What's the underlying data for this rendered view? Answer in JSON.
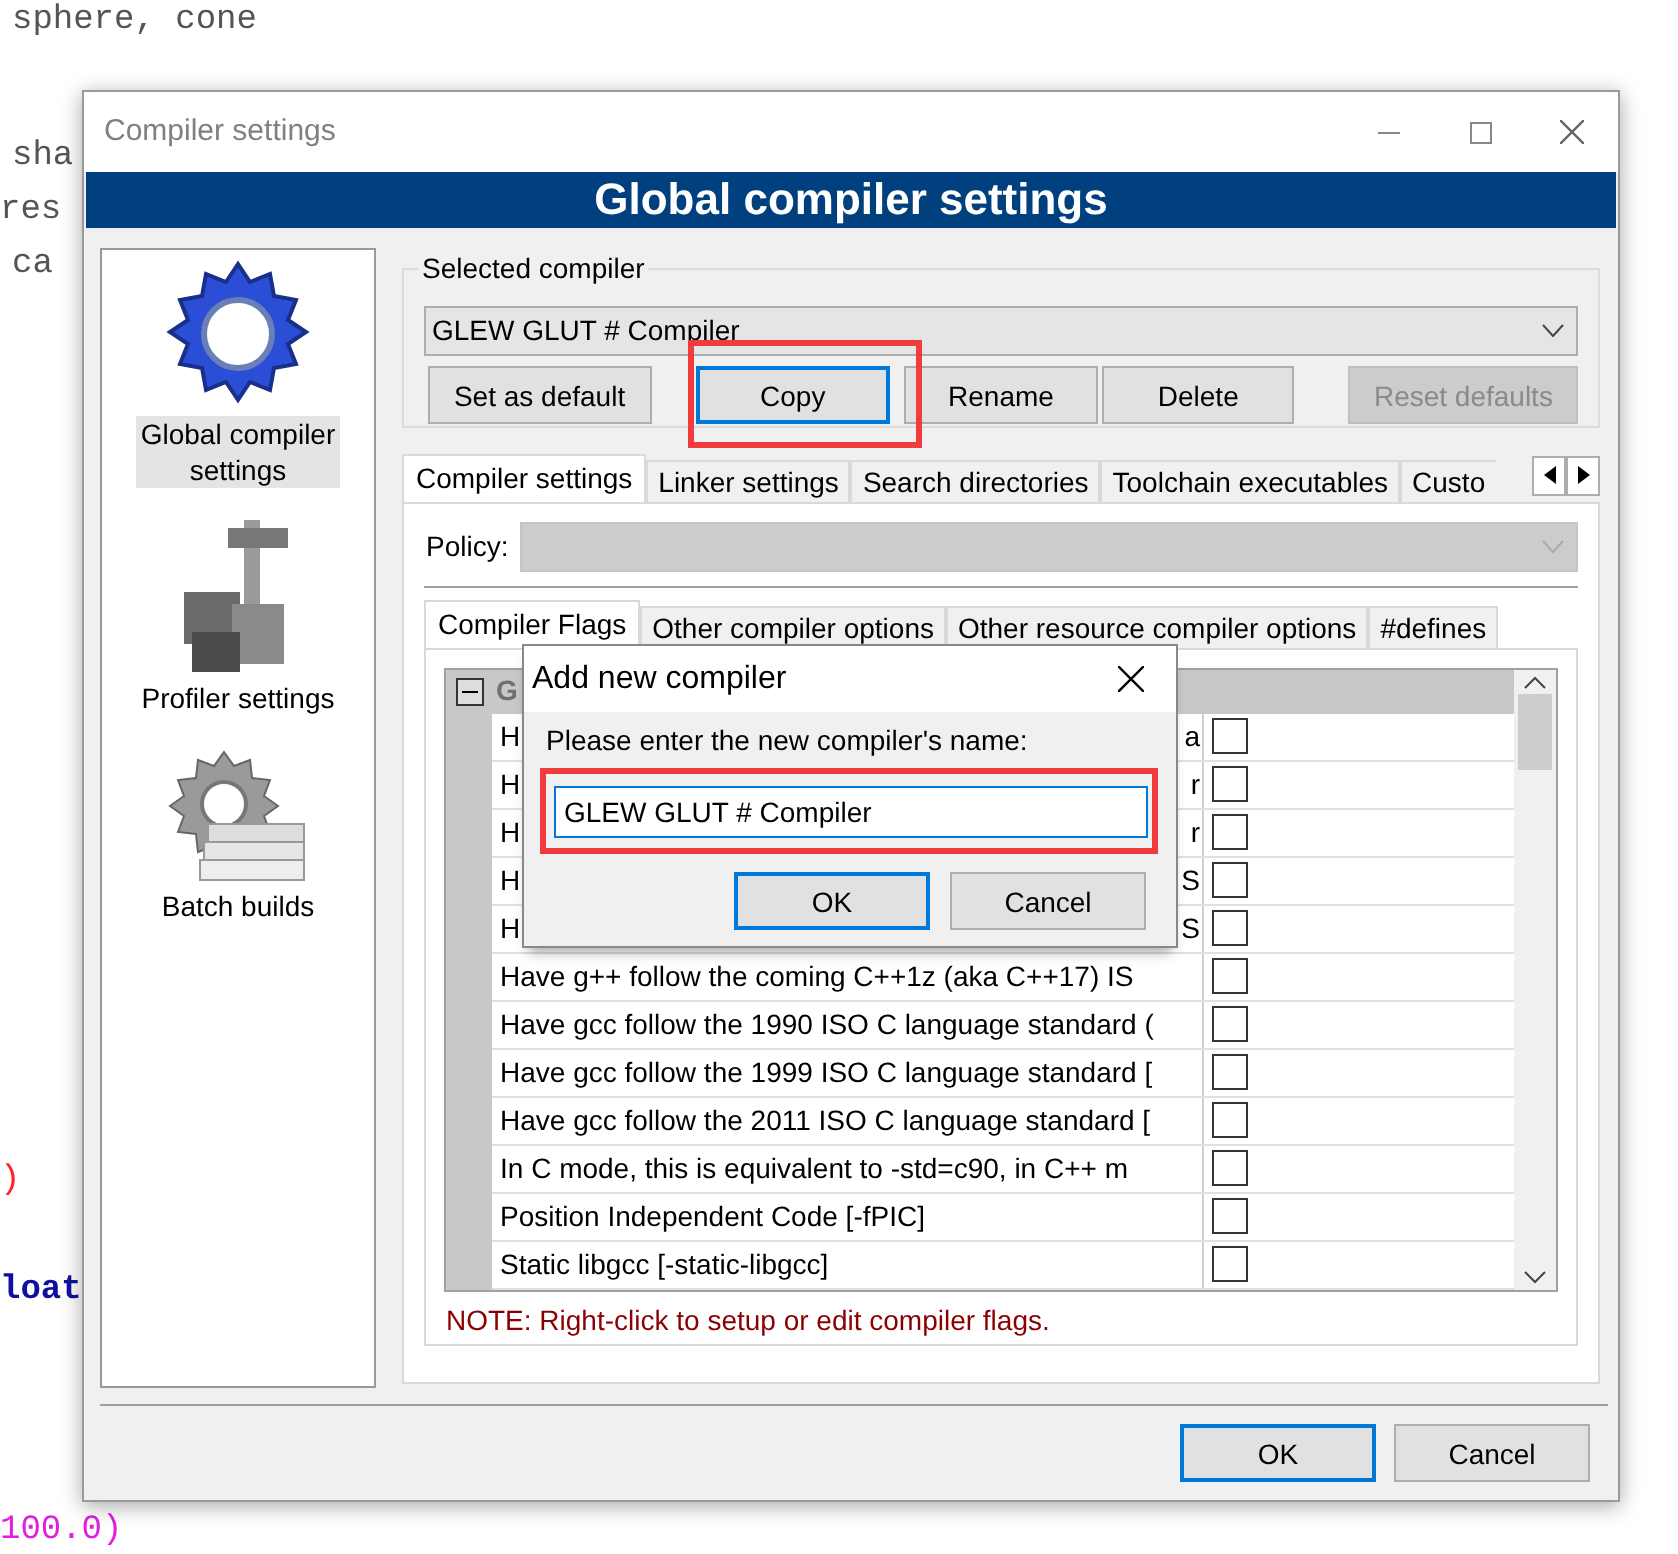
{
  "background_code": [
    {
      "text": "sphere, cone",
      "color": "#555555",
      "bold": false
    },
    {
      "text": "sha",
      "color": "#555555",
      "bold": false
    },
    {
      "text": "res",
      "color": "#555555",
      "bold": false
    },
    {
      "text": "ca",
      "color": "#555555",
      "bold": false
    },
    {
      "text": ")",
      "color": "#ff2020",
      "bold": false
    },
    {
      "text": "loat",
      "color": "#1010a0",
      "bold": true
    },
    {
      "text": "100.0)",
      "color": "#e020e0",
      "bold": false
    }
  ],
  "window": {
    "title": "Compiler settings"
  },
  "banner": "Global compiler settings",
  "sidebar": {
    "items": [
      {
        "label": "Global compiler settings",
        "selected": true,
        "kind": "gear"
      },
      {
        "label": "Profiler settings",
        "selected": false,
        "kind": "profiler"
      },
      {
        "label": "Batch builds",
        "selected": false,
        "kind": "batch"
      }
    ]
  },
  "selected_compiler": {
    "legend": "Selected compiler",
    "value": "GLEW GLUT # Compiler",
    "buttons": [
      {
        "label": "Set as default",
        "focused": false,
        "disabled": false,
        "highlighted": false
      },
      {
        "label": "Copy",
        "focused": true,
        "disabled": false,
        "highlighted": true
      },
      {
        "label": "Rename",
        "focused": false,
        "disabled": false,
        "highlighted": false
      },
      {
        "label": "Delete",
        "focused": false,
        "disabled": false,
        "highlighted": false
      },
      {
        "label": "Reset defaults",
        "focused": false,
        "disabled": true,
        "highlighted": false
      }
    ]
  },
  "tabs": [
    {
      "label": "Compiler settings",
      "selected": true
    },
    {
      "label": "Linker settings",
      "selected": false
    },
    {
      "label": "Search directories",
      "selected": false
    },
    {
      "label": "Toolchain executables",
      "selected": false
    },
    {
      "label": "Custo",
      "selected": false
    }
  ],
  "policy": {
    "label": "Policy:",
    "disabled": true
  },
  "inner_tabs": [
    {
      "label": "Compiler Flags",
      "selected": true
    },
    {
      "label": "Other compiler options",
      "selected": false
    },
    {
      "label": "Other resource compiler options",
      "selected": false
    },
    {
      "label": "#defines",
      "selected": false
    }
  ],
  "flags": {
    "group": {
      "label": "G",
      "expanded": true
    },
    "rows": [
      {
        "text": "H",
        "tail": "a",
        "checked": false
      },
      {
        "text": "H",
        "tail": "r",
        "checked": false
      },
      {
        "text": "H",
        "tail": "r",
        "checked": false
      },
      {
        "text": "H",
        "tail": "S",
        "checked": false
      },
      {
        "text": "H",
        "tail": "S",
        "checked": false
      },
      {
        "text": "Have g++ follow the coming C++1z (aka C++17) IS",
        "checked": false
      },
      {
        "text": "Have gcc follow the 1990 ISO C language standard  (",
        "checked": false
      },
      {
        "text": "Have gcc follow the 1999 ISO C language standard  [",
        "checked": false
      },
      {
        "text": "Have gcc follow the 2011 ISO C language standard  [",
        "checked": false
      },
      {
        "text": "In C mode, this is equivalent to -std=c90, in C++ m",
        "checked": false
      },
      {
        "text": "Position Independent Code  [-fPIC]",
        "checked": false
      },
      {
        "text": "Static libgcc  [-static-libgcc]",
        "checked": false
      }
    ]
  },
  "note": "NOTE: Right-click to setup or edit compiler flags.",
  "footer_buttons": [
    {
      "label": "OK",
      "focused": true
    },
    {
      "label": "Cancel",
      "focused": false
    }
  ],
  "dialog": {
    "title": "Add new compiler",
    "prompt": "Please enter the new compiler's name:",
    "value": "GLEW GLUT # Compiler",
    "highlighted": true,
    "buttons": [
      {
        "label": "OK",
        "focused": true
      },
      {
        "label": "Cancel",
        "focused": false
      }
    ]
  }
}
